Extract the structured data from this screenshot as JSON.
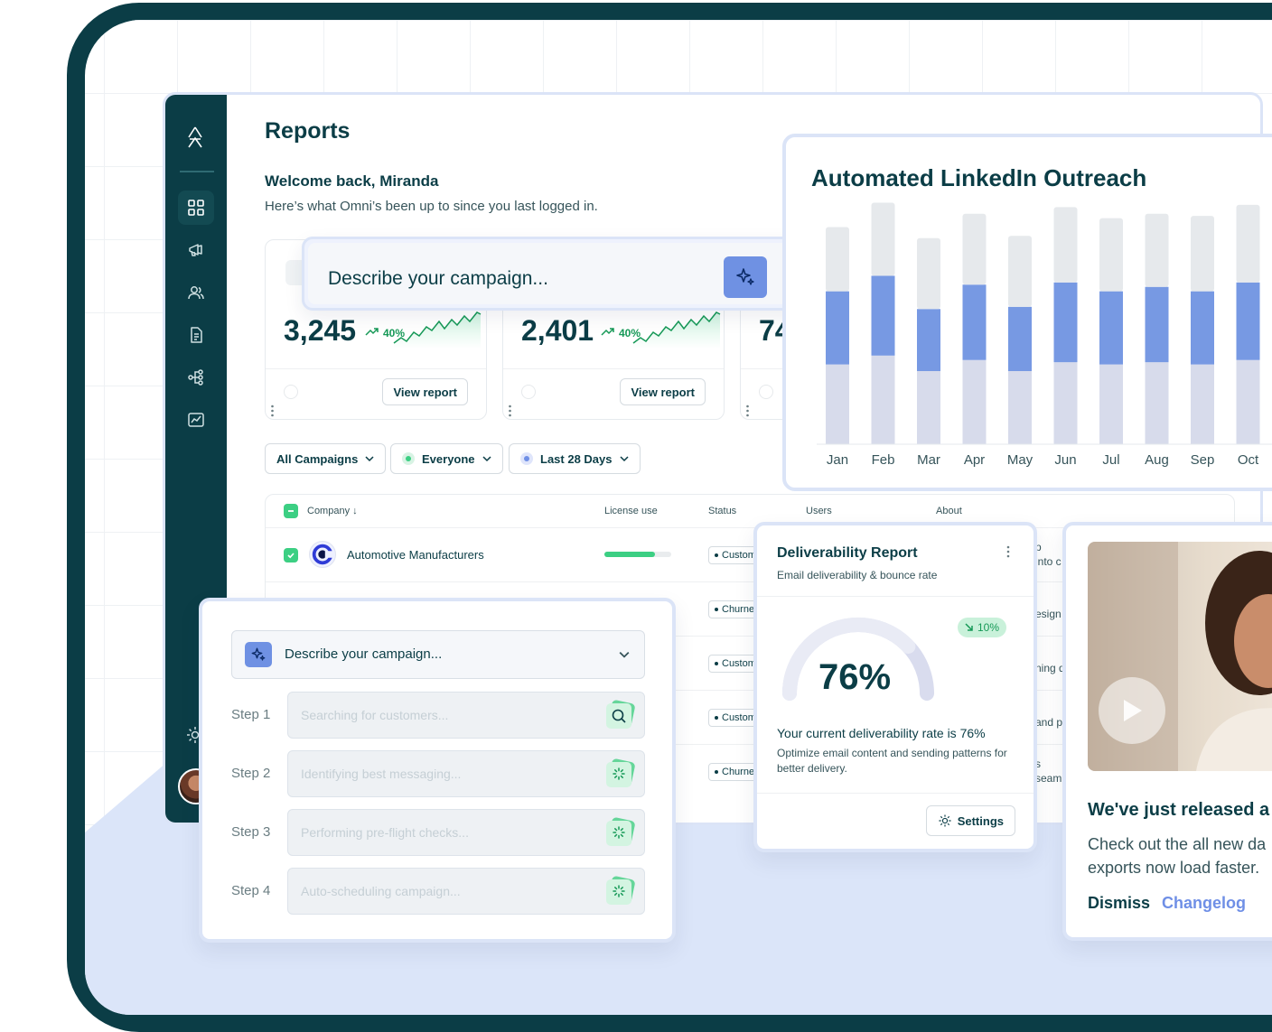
{
  "app": {
    "page_title": "Reports",
    "welcome": "Welcome back, Miranda",
    "subtext": "Here’s what Omni’s been up to since you last logged in."
  },
  "sidebar": {
    "items": [
      {
        "icon": "dashboard-grid-icon",
        "active": true
      },
      {
        "icon": "megaphone-icon"
      },
      {
        "icon": "users-icon"
      },
      {
        "icon": "document-icon"
      },
      {
        "icon": "workflow-icon"
      },
      {
        "icon": "chart-icon"
      }
    ],
    "settings_icon": "gear-icon"
  },
  "stats": [
    {
      "value": "3,245",
      "delta": "40%",
      "button": "View report"
    },
    {
      "value": "2,401",
      "delta": "40%",
      "button": "View report"
    },
    {
      "value": "74",
      "delta": "",
      "button": ""
    }
  ],
  "describe_top": {
    "label": "Describe your campaign..."
  },
  "filters": {
    "campaigns": "All Campaigns",
    "audience": "Everyone",
    "range": "Last 28 Days"
  },
  "table": {
    "headers": {
      "company": "Company",
      "license": "License use",
      "status": "Status",
      "users": "Users",
      "about": "About"
    },
    "rows": [
      {
        "company": "Automotive Manufacturers",
        "license": 0.75,
        "status": "Customer",
        "about": "p"
      },
      {
        "company": "",
        "license": 0,
        "status": "Churned",
        "about": "esign"
      },
      {
        "company": "",
        "license": 0,
        "status": "Customer",
        "about": "ning d"
      },
      {
        "company": "",
        "license": 0,
        "status": "Customer",
        "about": "and pr"
      },
      {
        "company": "",
        "license": 0,
        "status": "Churned",
        "about": "s"
      }
    ],
    "about_extra": [
      " into c",
      "seaml"
    ]
  },
  "chart_card": {
    "title": "Automated LinkedIn Outreach"
  },
  "chart_data": {
    "type": "bar",
    "title": "Automated LinkedIn Outreach",
    "categories": [
      "Jan",
      "Feb",
      "Mar",
      "Apr",
      "May",
      "Jun",
      "Jul",
      "Aug",
      "Sep",
      "Oct"
    ],
    "series": [
      {
        "values": [
          36,
          40,
          33,
          38,
          33,
          37,
          36,
          37,
          36,
          38
        ]
      },
      {
        "values": [
          33,
          36,
          28,
          34,
          29,
          36,
          33,
          34,
          33,
          35
        ]
      },
      {
        "values": [
          29,
          33,
          32,
          32,
          32,
          34,
          33,
          33,
          34,
          35
        ]
      }
    ],
    "stacked": true,
    "colors": [
      "#d7dbeb",
      "#7799e3",
      "#e6e9ec"
    ],
    "ylim": [
      0,
      110
    ]
  },
  "steps_card": {
    "head_label": "Describe your campaign...",
    "steps": [
      {
        "label": "Step 1",
        "placeholder": "Searching for customers...",
        "icon": "search-icon"
      },
      {
        "label": "Step 2",
        "placeholder": "Identifying best messaging...",
        "icon": "spinner-icon"
      },
      {
        "label": "Step 3",
        "placeholder": "Performing pre-flight checks...",
        "icon": "spinner-icon"
      },
      {
        "label": "Step 4",
        "placeholder": "Auto-scheduling campaign...",
        "icon": "spinner-icon"
      }
    ]
  },
  "deliverability": {
    "title": "Deliverability Report",
    "subtitle": "Email deliverability & bounce rate",
    "value": "76%",
    "gauge_fraction": 0.76,
    "badge": "10%",
    "rate_text": "Your current deliverability rate is 76%",
    "tip": "Optimize email content and sending patterns for better delivery.",
    "settings": "Settings"
  },
  "release": {
    "title": "We've just released a",
    "body_line1": "Check out the all new da",
    "body_line2": "exports now load faster.",
    "dismiss": "Dismiss",
    "changelog": "Changelog"
  },
  "colors": {
    "brand_dark": "#0b3d46",
    "accent_blue": "#6f91e3",
    "accent_green": "#3ccf83",
    "frame_border": "#dbe4f7"
  }
}
